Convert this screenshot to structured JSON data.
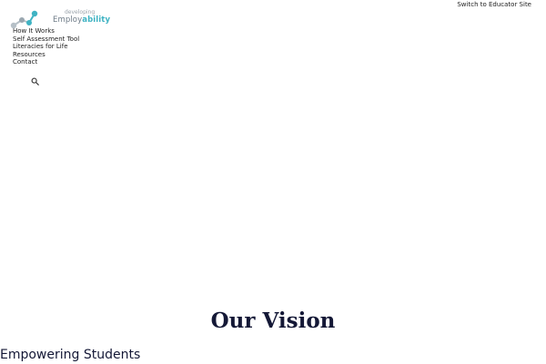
{
  "header": {
    "logo": {
      "small_text": "developing",
      "main_text": "Employ",
      "accent_text": "ability",
      "accent_color": "#3fb3c3",
      "text_color": "#6d7a86"
    },
    "switch_link": "Switch to Educator Site"
  },
  "nav": {
    "items": [
      {
        "label": "How It Works"
      },
      {
        "label": "Self Assessment Tool"
      },
      {
        "label": "Literacies for Life"
      },
      {
        "label": "Resources"
      },
      {
        "label": "Contact"
      }
    ],
    "search_icon": "search-icon"
  },
  "main": {
    "title": "Our Vision",
    "subtitle": "Empowering Students",
    "title_color": "#141836"
  }
}
